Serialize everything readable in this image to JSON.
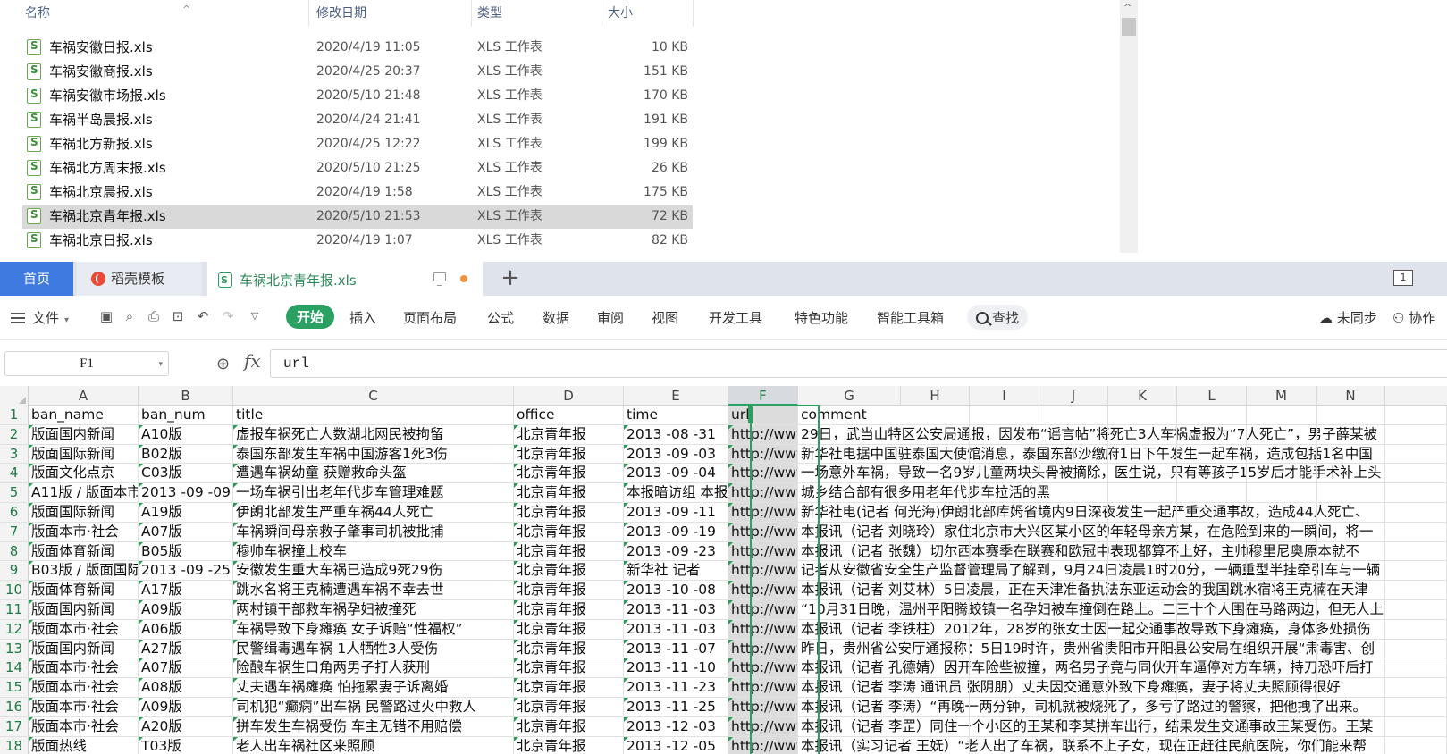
{
  "explorer": {
    "columns": [
      "名称",
      "修改日期",
      "类型",
      "大小"
    ],
    "files": [
      {
        "name": "车祸安徽日报.xls",
        "date": "2020/4/19 11:05",
        "type": "XLS 工作表",
        "size": "10 KB"
      },
      {
        "name": "车祸安徽商报.xls",
        "date": "2020/4/25 20:37",
        "type": "XLS 工作表",
        "size": "151 KB"
      },
      {
        "name": "车祸安徽市场报.xls",
        "date": "2020/5/10 21:48",
        "type": "XLS 工作表",
        "size": "170 KB"
      },
      {
        "name": "车祸半岛晨报.xls",
        "date": "2020/4/24 21:41",
        "type": "XLS 工作表",
        "size": "191 KB"
      },
      {
        "name": "车祸北方新报.xls",
        "date": "2020/4/25 12:22",
        "type": "XLS 工作表",
        "size": "199 KB"
      },
      {
        "name": "车祸北方周末报.xls",
        "date": "2020/5/10 21:25",
        "type": "XLS 工作表",
        "size": "26 KB"
      },
      {
        "name": "车祸北京晨报.xls",
        "date": "2020/4/19 1:58",
        "type": "XLS 工作表",
        "size": "175 KB"
      },
      {
        "name": "车祸北京青年报.xls",
        "date": "2020/5/10 21:53",
        "type": "XLS 工作表",
        "size": "72 KB"
      },
      {
        "name": "车祸北京日报.xls",
        "date": "2020/4/19 1:07",
        "type": "XLS 工作表",
        "size": "82 KB"
      }
    ],
    "selected_index": 7
  },
  "tabs": {
    "home": "首页",
    "template": "稻壳模板",
    "file": "车祸北京青年报.xls",
    "window_indicator": "1"
  },
  "ribbon": {
    "file_menu": "文件",
    "tabs": [
      "开始",
      "插入",
      "页面布局",
      "公式",
      "数据",
      "审阅",
      "视图",
      "开发工具",
      "特色功能",
      "智能工具箱"
    ],
    "active_tab": 0,
    "search": "查找",
    "sync": "未同步",
    "collab": "协作"
  },
  "formula_bar": {
    "cell_ref": "F1",
    "fx": "fx",
    "value": "url"
  },
  "grid": {
    "columns": [
      "A",
      "B",
      "C",
      "D",
      "E",
      "F",
      "G",
      "H",
      "I",
      "J",
      "K",
      "L",
      "M",
      "N"
    ],
    "selected_column": "F",
    "rows": [
      {
        "n": "1",
        "a": "ban_name",
        "b": "ban_num",
        "c": "title",
        "d": "office",
        "e": "time",
        "f": "url",
        "g": "comment"
      },
      {
        "n": "2",
        "a": "版面国内新闻",
        "b": "A10版",
        "c": "虚报车祸死亡人数湖北网民被拘留",
        "d": "北京青年报",
        "e": " 2013 -08 -31",
        "f": "http://www",
        "g": "29日，武当山特区公安局通报，因发布“谣言帖”将死亡3人车祸虚报为“7人死亡”，男子薛某被"
      },
      {
        "n": "3",
        "a": "版面国际新闻",
        "b": "B02版",
        "c": "泰国东部发生车祸中国游客1死3伤",
        "d": "北京青年报",
        "e": " 2013 -09 -03",
        "f": "http://www",
        "g": "新华社电据中国驻泰国大使馆消息，泰国东部沙缴府1日下午发生一起车祸，造成包括1名中国"
      },
      {
        "n": "4",
        "a": "版面文化点京",
        "b": "C03版",
        "c": "遭遇车祸幼童 获赠救命头盔",
        "d": "北京青年报",
        "e": " 2013 -09 -04",
        "f": "http://www",
        "g": "一场意外车祸，导致一名9岁儿童两块头骨被摘除，医生说，只有等孩子15岁后才能手术补上头"
      },
      {
        "n": "5",
        "a": "A11版 / 版面本市",
        "b": "2013 -09 -09",
        "c": "一场车祸引出老年代步车管理难题",
        "d": "北京青年报",
        "e": "本报暗访组  本报",
        "f": "http://www",
        "g": "城乡结合部有很多用老年代步车拉活的黑"
      },
      {
        "n": "6",
        "a": "版面国际新闻",
        "b": "A19版",
        "c": "伊朗北部发生严重车祸44人死亡",
        "d": "北京青年报",
        "e": " 2013 -09 -11",
        "f": "http://www",
        "g": "新华社电(记者   何光海)伊朗北部库姆省境内9日深夜发生一起严重交通事故，造成44人死亡、"
      },
      {
        "n": "7",
        "a": "版面本市·社会",
        "b": "A07版",
        "c": "车祸瞬间母亲救子肇事司机被批捕",
        "d": "北京青年报",
        "e": " 2013 -09 -19",
        "f": "http://www",
        "g": "本报讯（记者 刘晓玲）家住北京市大兴区某小区的年轻母亲方某，在危险到来的一瞬间，将一"
      },
      {
        "n": "8",
        "a": "版面体育新闻",
        "b": "B05版",
        "c": "穆帅车祸撞上校车",
        "d": "北京青年报",
        "e": " 2013 -09 -23",
        "f": "http://www",
        "g": "本报讯（记者   张魏）切尔西本赛季在联赛和欧冠中表现都算不上好，主帅穆里尼奥原本就不"
      },
      {
        "n": "9",
        "a": "B03版 / 版面国际",
        "b": "2013 -09 -25",
        "c": "安徽发生重大车祸已造成9死29伤",
        "d": "北京青年报",
        "e": "新华社    记者",
        "f": "http://www",
        "g": "记者从安徽省安全生产监督管理局了解到，9月24日凌晨1时20分，一辆重型半挂牵引车与一辆"
      },
      {
        "n": "10",
        "a": "版面体育新闻",
        "b": "A17版",
        "c": "跳水名将王克楠遭遇车祸不幸去世",
        "d": "北京青年报",
        "e": " 2013 -10 -08",
        "f": "http://www",
        "g": "本报讯（记者 刘艾林）5日凌晨，正在天津准备执法东亚运动会的我国跳水宿将王克楠在天津"
      },
      {
        "n": "11",
        "a": "版面国内新闻",
        "b": "A09版",
        "c": "两村镇干部救车祸孕妇被撞死",
        "d": "北京青年报",
        "e": " 2013 -11 -03",
        "f": "http://www",
        "g": "“10月31日晚，温州平阳腾蛟镇一名孕妇被车撞倒在路上。二三十个人围在马路两边，但无人上"
      },
      {
        "n": "12",
        "a": "版面本市·社会",
        "b": "A06版",
        "c": "车祸导致下身瘫痪 女子诉赔“性福权”",
        "d": "北京青年报",
        "e": " 2013 -11 -03",
        "f": "http://www",
        "g": "本报讯（记者   李铁柱）2012年，28岁的张女士因一起交通事故导致下身瘫痪，身体多处损伤"
      },
      {
        "n": "13",
        "a": "版面国内新闻",
        "b": "A27版",
        "c": "民警缉毒遇车祸 1人牺牲3人受伤",
        "d": "北京青年报",
        "e": " 2013 -11 -07",
        "f": "http://www",
        "g": "昨日，贵州省公安厅通报称：5日19时许，贵州省贵阳市开阳县公安局在组织开展“肃毒害、创"
      },
      {
        "n": "14",
        "a": "版面本市·社会",
        "b": "A07版",
        "c": "险酿车祸生口角两男子打人获刑",
        "d": "北京青年报",
        "e": " 2013 -11 -10",
        "f": "http://www",
        "g": "本报讯（记者 孔德婧）因开车险些被撞，两名男子竟与同伙开车逼停对方车辆，持刀恐吓后打"
      },
      {
        "n": "15",
        "a": "版面本市·社会",
        "b": "A08版",
        "c": "丈夫遇车祸瘫痪 怕拖累妻子诉离婚",
        "d": "北京青年报",
        "e": " 2013 -11 -23",
        "f": "http://www",
        "g": "本报讯（记者   李涛   通讯员   张阴朋）丈夫因交通意外致下身瘫痪，妻子将丈夫照顾得很好"
      },
      {
        "n": "16",
        "a": "版面本市·社会",
        "b": "A09版",
        "c": "司机犯“癫痫”出车祸 民警路过火中救人",
        "d": "北京青年报",
        "e": " 2013 -11 -25",
        "f": "http://www",
        "g": "本报讯（记者   李涛）“再晚一两分钟，司机就被烧死了，多亏了路过的警察，把他拽了出来。"
      },
      {
        "n": "17",
        "a": "版面本市·社会",
        "b": "A20版",
        "c": "拼车发生车祸受伤 车主无错不用赔偿",
        "d": "北京青年报",
        "e": " 2013 -12 -03",
        "f": "http://www",
        "g": "本报讯（记者 李罡）同住一个小区的王某和李某拼车出行，结果发生交通事故王某受伤。王某"
      },
      {
        "n": "18",
        "a": "版面热线",
        "b": "T03版",
        "c": "老人出车祸社区来照顾",
        "d": "北京青年报",
        "e": " 2013 -12 -05",
        "f": "http://www",
        "g": "本报讯（实习记者   王妩）“老人出了车祸，联系不上子女，现在正赶往民航医院，你们能来帮"
      }
    ]
  }
}
